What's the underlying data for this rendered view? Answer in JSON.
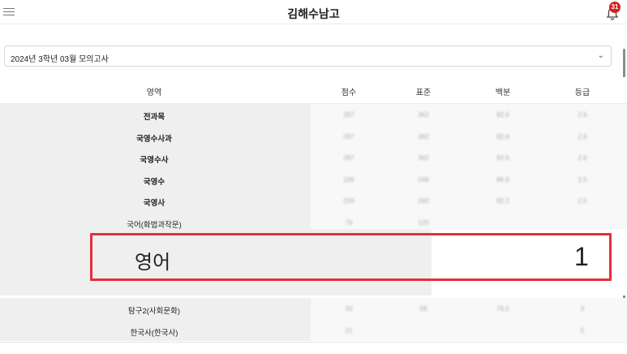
{
  "header": {
    "title": "김해수남고",
    "notification_count": "31",
    "menu_icon": "hamburger-icon",
    "bell_icon": "bell-icon"
  },
  "exam_select": {
    "value": "2024년 3학년 03월 모의고사",
    "chevron": "⌄"
  },
  "table": {
    "columns": [
      "영역",
      "점수",
      "표준",
      "백분",
      "등급"
    ],
    "rows": [
      {
        "name": "전과목",
        "bold": true,
        "score": "297",
        "standard": "362",
        "percentile": "82.6",
        "grade": "2.6"
      },
      {
        "name": "국영수사과",
        "bold": true,
        "score": "297",
        "standard": "362",
        "percentile": "82.6",
        "grade": "2.6"
      },
      {
        "name": "국영수사",
        "bold": true,
        "score": "297",
        "standard": "362",
        "percentile": "82.6",
        "grade": "2.6"
      },
      {
        "name": "국영수",
        "bold": true,
        "score": "236",
        "standard": "248",
        "percentile": "86.6",
        "grade": "2.5"
      },
      {
        "name": "국영사",
        "bold": true,
        "score": "226",
        "standard": "240",
        "percentile": "82.2",
        "grade": "2.5"
      },
      {
        "name": "국어(화법과작문)",
        "bold": false,
        "score": "79",
        "standard": "120",
        "percentile": "",
        "grade": ""
      },
      {
        "name": "탐구2(사회문화)",
        "bold": false,
        "score": "33",
        "standard": "58",
        "percentile": "79.5",
        "grade": "3"
      },
      {
        "name": "한국사(한국사)",
        "bold": false,
        "score": "21",
        "standard": "",
        "percentile": "",
        "grade": "5"
      }
    ],
    "highlight": {
      "name": "영어",
      "grade": "1"
    }
  },
  "colors": {
    "highlight_border": "#e0323a",
    "badge": "#d32020"
  }
}
